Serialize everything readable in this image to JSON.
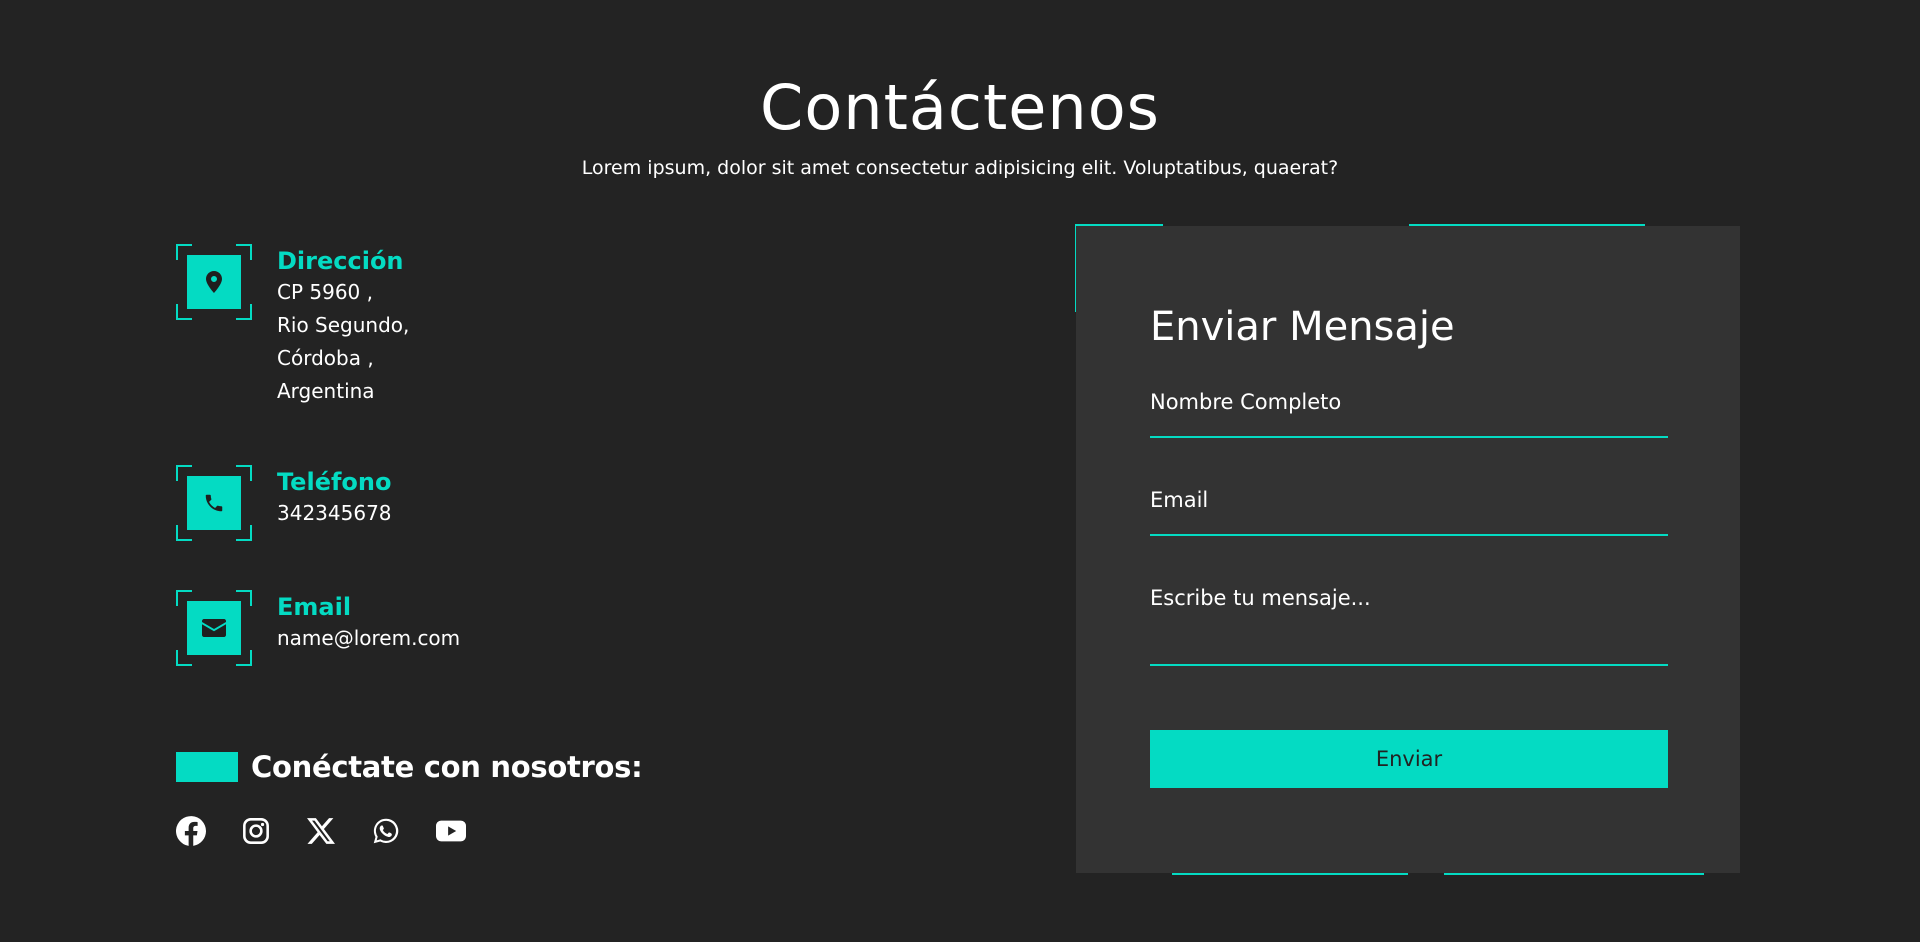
{
  "header": {
    "title": "Contáctenos",
    "subtitle": "Lorem ipsum, dolor sit amet consectetur adipisicing elit. Voluptatibus, quaerat?"
  },
  "contact": {
    "address": {
      "icon": "map-pin-icon",
      "heading": "Dirección",
      "lines": [
        "CP 5960 ,",
        "Rio Segundo,",
        "Córdoba ,",
        "Argentina"
      ]
    },
    "phone": {
      "icon": "phone-icon",
      "heading": "Teléfono",
      "value": "342345678"
    },
    "email": {
      "icon": "envelope-icon",
      "heading": "Email",
      "value": "name@lorem.com"
    }
  },
  "social": {
    "label": "Conéctate con nosotros:",
    "icons": [
      "facebook-icon",
      "instagram-icon",
      "x-icon",
      "whatsapp-icon",
      "youtube-icon"
    ]
  },
  "form": {
    "title": "Enviar Mensaje",
    "name_placeholder": "Nombre Completo",
    "email_placeholder": "Email",
    "message_placeholder": "Escribe tu mensaje...",
    "submit_label": "Enviar"
  },
  "colors": {
    "background": "#232323",
    "card": "#333333",
    "accent": "#04dbc3",
    "text": "#ffffff"
  }
}
